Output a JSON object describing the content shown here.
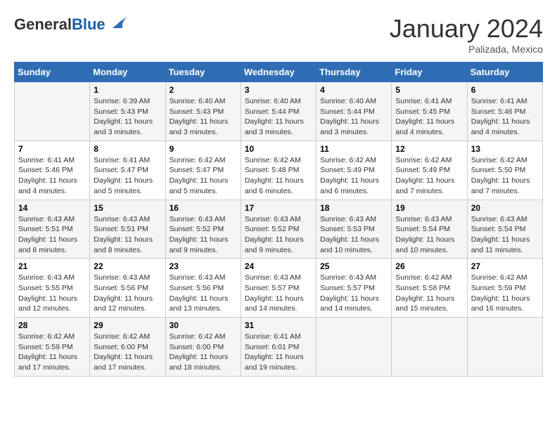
{
  "header": {
    "logo_general": "General",
    "logo_blue": "Blue",
    "month_title": "January 2024",
    "location": "Palizada, Mexico"
  },
  "weekdays": [
    "Sunday",
    "Monday",
    "Tuesday",
    "Wednesday",
    "Thursday",
    "Friday",
    "Saturday"
  ],
  "weeks": [
    [
      {
        "day": "",
        "sunrise": "",
        "sunset": "",
        "daylight": ""
      },
      {
        "day": "1",
        "sunrise": "Sunrise: 6:39 AM",
        "sunset": "Sunset: 5:43 PM",
        "daylight": "Daylight: 11 hours and 3 minutes."
      },
      {
        "day": "2",
        "sunrise": "Sunrise: 6:40 AM",
        "sunset": "Sunset: 5:43 PM",
        "daylight": "Daylight: 11 hours and 3 minutes."
      },
      {
        "day": "3",
        "sunrise": "Sunrise: 6:40 AM",
        "sunset": "Sunset: 5:44 PM",
        "daylight": "Daylight: 11 hours and 3 minutes."
      },
      {
        "day": "4",
        "sunrise": "Sunrise: 6:40 AM",
        "sunset": "Sunset: 5:44 PM",
        "daylight": "Daylight: 11 hours and 3 minutes."
      },
      {
        "day": "5",
        "sunrise": "Sunrise: 6:41 AM",
        "sunset": "Sunset: 5:45 PM",
        "daylight": "Daylight: 11 hours and 4 minutes."
      },
      {
        "day": "6",
        "sunrise": "Sunrise: 6:41 AM",
        "sunset": "Sunset: 5:46 PM",
        "daylight": "Daylight: 11 hours and 4 minutes."
      }
    ],
    [
      {
        "day": "7",
        "sunrise": "Sunrise: 6:41 AM",
        "sunset": "Sunset: 5:46 PM",
        "daylight": "Daylight: 11 hours and 4 minutes."
      },
      {
        "day": "8",
        "sunrise": "Sunrise: 6:41 AM",
        "sunset": "Sunset: 5:47 PM",
        "daylight": "Daylight: 11 hours and 5 minutes."
      },
      {
        "day": "9",
        "sunrise": "Sunrise: 6:42 AM",
        "sunset": "Sunset: 5:47 PM",
        "daylight": "Daylight: 11 hours and 5 minutes."
      },
      {
        "day": "10",
        "sunrise": "Sunrise: 6:42 AM",
        "sunset": "Sunset: 5:48 PM",
        "daylight": "Daylight: 11 hours and 6 minutes."
      },
      {
        "day": "11",
        "sunrise": "Sunrise: 6:42 AM",
        "sunset": "Sunset: 5:49 PM",
        "daylight": "Daylight: 11 hours and 6 minutes."
      },
      {
        "day": "12",
        "sunrise": "Sunrise: 6:42 AM",
        "sunset": "Sunset: 5:49 PM",
        "daylight": "Daylight: 11 hours and 7 minutes."
      },
      {
        "day": "13",
        "sunrise": "Sunrise: 6:42 AM",
        "sunset": "Sunset: 5:50 PM",
        "daylight": "Daylight: 11 hours and 7 minutes."
      }
    ],
    [
      {
        "day": "14",
        "sunrise": "Sunrise: 6:43 AM",
        "sunset": "Sunset: 5:51 PM",
        "daylight": "Daylight: 11 hours and 8 minutes."
      },
      {
        "day": "15",
        "sunrise": "Sunrise: 6:43 AM",
        "sunset": "Sunset: 5:51 PM",
        "daylight": "Daylight: 11 hours and 8 minutes."
      },
      {
        "day": "16",
        "sunrise": "Sunrise: 6:43 AM",
        "sunset": "Sunset: 5:52 PM",
        "daylight": "Daylight: 11 hours and 9 minutes."
      },
      {
        "day": "17",
        "sunrise": "Sunrise: 6:43 AM",
        "sunset": "Sunset: 5:52 PM",
        "daylight": "Daylight: 11 hours and 9 minutes."
      },
      {
        "day": "18",
        "sunrise": "Sunrise: 6:43 AM",
        "sunset": "Sunset: 5:53 PM",
        "daylight": "Daylight: 11 hours and 10 minutes."
      },
      {
        "day": "19",
        "sunrise": "Sunrise: 6:43 AM",
        "sunset": "Sunset: 5:54 PM",
        "daylight": "Daylight: 11 hours and 10 minutes."
      },
      {
        "day": "20",
        "sunrise": "Sunrise: 6:43 AM",
        "sunset": "Sunset: 5:54 PM",
        "daylight": "Daylight: 11 hours and 11 minutes."
      }
    ],
    [
      {
        "day": "21",
        "sunrise": "Sunrise: 6:43 AM",
        "sunset": "Sunset: 5:55 PM",
        "daylight": "Daylight: 11 hours and 12 minutes."
      },
      {
        "day": "22",
        "sunrise": "Sunrise: 6:43 AM",
        "sunset": "Sunset: 5:56 PM",
        "daylight": "Daylight: 11 hours and 12 minutes."
      },
      {
        "day": "23",
        "sunrise": "Sunrise: 6:43 AM",
        "sunset": "Sunset: 5:56 PM",
        "daylight": "Daylight: 11 hours and 13 minutes."
      },
      {
        "day": "24",
        "sunrise": "Sunrise: 6:43 AM",
        "sunset": "Sunset: 5:57 PM",
        "daylight": "Daylight: 11 hours and 14 minutes."
      },
      {
        "day": "25",
        "sunrise": "Sunrise: 6:43 AM",
        "sunset": "Sunset: 5:57 PM",
        "daylight": "Daylight: 11 hours and 14 minutes."
      },
      {
        "day": "26",
        "sunrise": "Sunrise: 6:42 AM",
        "sunset": "Sunset: 5:58 PM",
        "daylight": "Daylight: 11 hours and 15 minutes."
      },
      {
        "day": "27",
        "sunrise": "Sunrise: 6:42 AM",
        "sunset": "Sunset: 5:59 PM",
        "daylight": "Daylight: 11 hours and 16 minutes."
      }
    ],
    [
      {
        "day": "28",
        "sunrise": "Sunrise: 6:42 AM",
        "sunset": "Sunset: 5:59 PM",
        "daylight": "Daylight: 11 hours and 17 minutes."
      },
      {
        "day": "29",
        "sunrise": "Sunrise: 6:42 AM",
        "sunset": "Sunset: 6:00 PM",
        "daylight": "Daylight: 11 hours and 17 minutes."
      },
      {
        "day": "30",
        "sunrise": "Sunrise: 6:42 AM",
        "sunset": "Sunset: 6:00 PM",
        "daylight": "Daylight: 11 hours and 18 minutes."
      },
      {
        "day": "31",
        "sunrise": "Sunrise: 6:41 AM",
        "sunset": "Sunset: 6:01 PM",
        "daylight": "Daylight: 11 hours and 19 minutes."
      },
      {
        "day": "",
        "sunrise": "",
        "sunset": "",
        "daylight": ""
      },
      {
        "day": "",
        "sunrise": "",
        "sunset": "",
        "daylight": ""
      },
      {
        "day": "",
        "sunrise": "",
        "sunset": "",
        "daylight": ""
      }
    ]
  ]
}
